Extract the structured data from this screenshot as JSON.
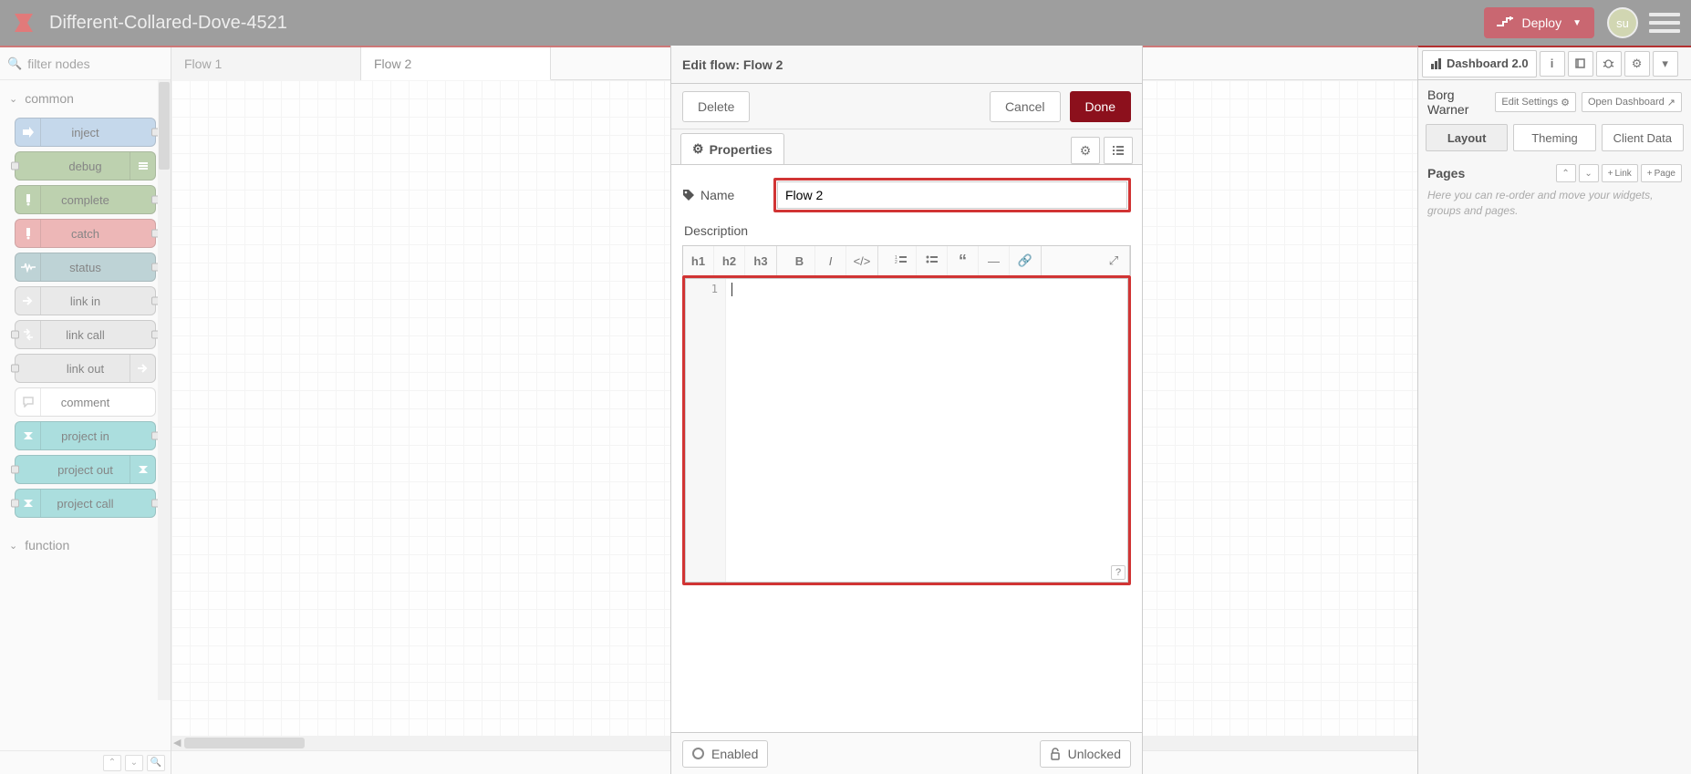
{
  "header": {
    "app_title": "Different-Collared-Dove-4521",
    "deploy_label": "Deploy",
    "avatar_initials": "su"
  },
  "palette": {
    "search_placeholder": "filter nodes",
    "categories": [
      {
        "name": "common",
        "expanded": true
      },
      {
        "name": "function",
        "expanded": false
      }
    ],
    "nodes": {
      "inject": "inject",
      "debug": "debug",
      "complete": "complete",
      "catch": "catch",
      "status": "status",
      "link_in": "link in",
      "link_call": "link call",
      "link_out": "link out",
      "comment": "comment",
      "project_in": "project in",
      "project_out": "project out",
      "project_call": "project call"
    }
  },
  "canvas": {
    "tabs": [
      {
        "label": "Flow 1",
        "active": false
      },
      {
        "label": "Flow 2",
        "active": true
      }
    ]
  },
  "tray": {
    "title": "Edit flow: Flow 2",
    "delete_label": "Delete",
    "cancel_label": "Cancel",
    "done_label": "Done",
    "properties_tab": "Properties",
    "name_label": "Name",
    "name_value": "Flow 2",
    "description_label": "Description",
    "md_buttons": {
      "h1": "h1",
      "h2": "h2",
      "h3": "h3"
    },
    "editor_line_number": "1",
    "enabled_label": "Enabled",
    "unlocked_label": "Unlocked"
  },
  "sidebar": {
    "main_tab": "Dashboard 2.0",
    "project_name": "Borg Warner",
    "edit_settings_label": "Edit Settings",
    "open_dashboard_label": "Open Dashboard",
    "sub_tabs": {
      "layout": "Layout",
      "theming": "Theming",
      "client_data": "Client Data"
    },
    "pages_title": "Pages",
    "add_link_label": "Link",
    "add_page_label": "Page",
    "hint": "Here you can re-order and move your widgets, groups and pages."
  }
}
